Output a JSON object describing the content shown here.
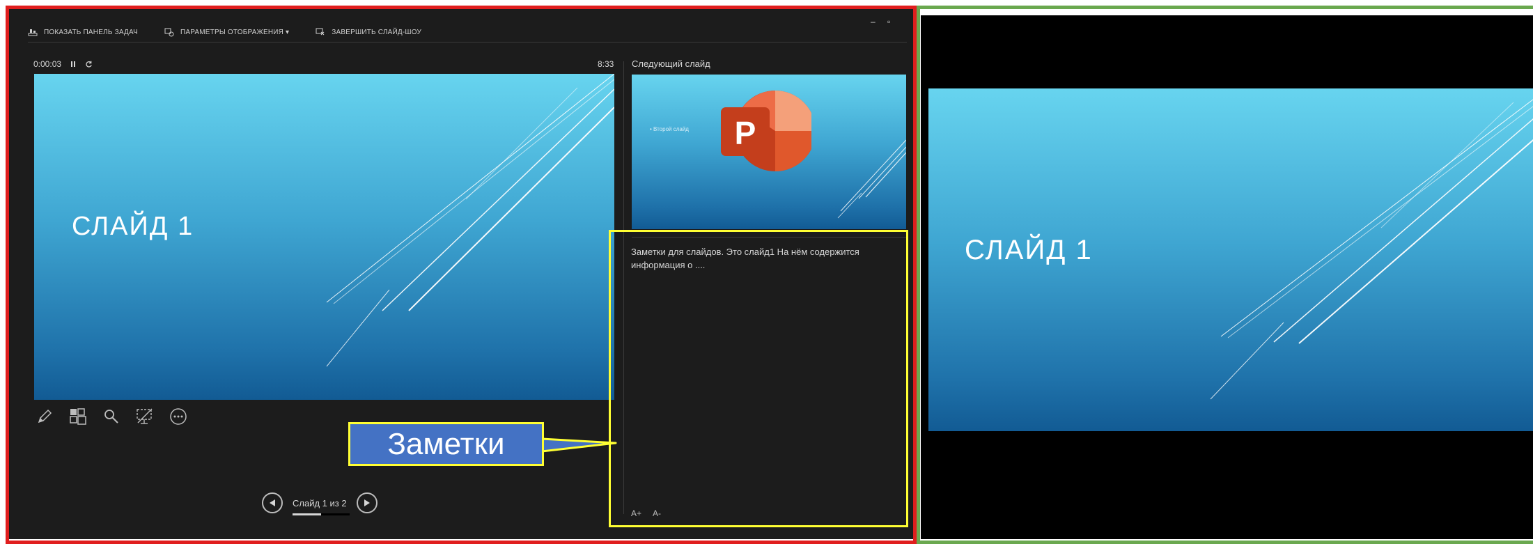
{
  "toolbar": {
    "items": [
      {
        "label": "ПОКАЗАТЬ ПАНЕЛЬ ЗАДАЧ",
        "icon": "taskbar-icon"
      },
      {
        "label": "ПАРАМЕТРЫ ОТОБРАЖЕНИЯ ▾",
        "icon": "display-settings-icon"
      },
      {
        "label": "ЗАВЕРШИТЬ СЛАЙД-ШОУ",
        "icon": "end-show-icon"
      }
    ],
    "minimize": "–",
    "restore": "▫"
  },
  "timer": {
    "elapsed": "0:00:03",
    "pause_icon": "pause-icon",
    "reset_icon": "reset-icon"
  },
  "clock": "8:33",
  "current_slide": {
    "title": "СЛАЙД 1"
  },
  "next_slide": {
    "label": "Следующий слайд",
    "bullet": "• Второй слайд"
  },
  "notes": {
    "text": "Заметки для слайдов. Это слайд1 На нём содержится информация о ....",
    "increase_font": "A+",
    "decrease_font": "A-"
  },
  "callout": {
    "label": "Заметки"
  },
  "pager": {
    "label": "Слайд 1 из 2",
    "progress": 0.5
  },
  "audience_slide": {
    "title": "СЛАЙД 1"
  },
  "colors": {
    "presenter_frame": "#e01e1e",
    "audience_frame": "#6aa84f",
    "notes_highlight": "#ffff33",
    "callout_bg": "#4472c4",
    "ppt_brand": "#d04423"
  }
}
